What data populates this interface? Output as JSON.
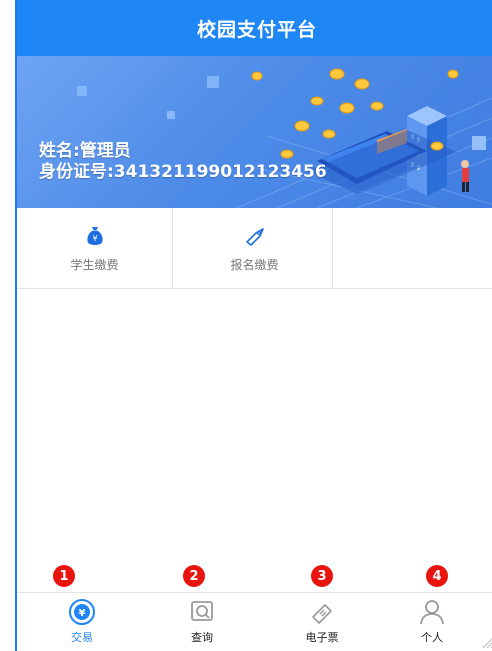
{
  "header": {
    "title": "校园支付平台"
  },
  "banner": {
    "name_line": "姓名:管理员",
    "id_line": "身份证号:341321199012123456"
  },
  "services": [
    {
      "label": "学生缴费",
      "icon": "money-bag-icon"
    },
    {
      "label": "报名缴费",
      "icon": "tag-icon"
    }
  ],
  "markers": [
    "1",
    "2",
    "3",
    "4"
  ],
  "tabs": [
    {
      "label": "交易",
      "icon": "yuan-coin-icon",
      "active": true
    },
    {
      "label": "查询",
      "icon": "search-icon",
      "active": false
    },
    {
      "label": "电子票",
      "icon": "ticket-icon",
      "active": false
    },
    {
      "label": "个人",
      "icon": "person-icon",
      "active": false
    }
  ],
  "colors": {
    "primary": "#1f86f5",
    "marker": "#e8150e",
    "inactive_icon": "#9a9a9a"
  }
}
